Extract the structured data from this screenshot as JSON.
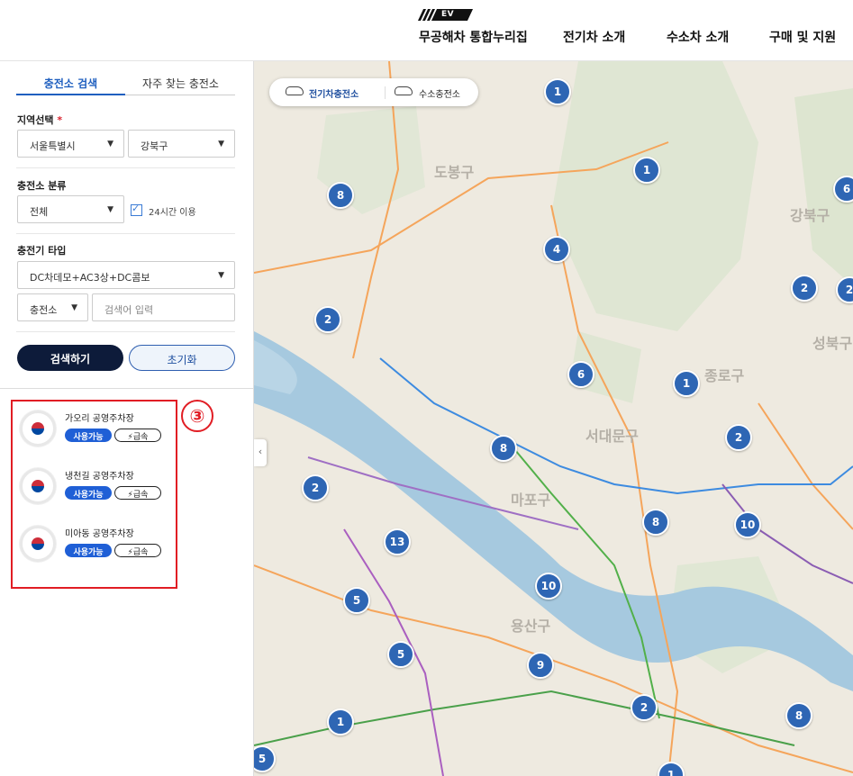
{
  "header": {
    "logo_tag": "EV",
    "nav": [
      "무공해차 통합누리집",
      "전기차 소개",
      "수소차 소개",
      "구매 및 지원"
    ]
  },
  "sidebar": {
    "tabs": [
      "충전소 검색",
      "자주 찾는 충전소"
    ],
    "region": {
      "label": "지역선택",
      "required_mark": "*",
      "city": "서울특별시",
      "district": "강북구"
    },
    "category": {
      "label": "충전소 분류",
      "value": "전체",
      "checkbox_label": "24시간 이용",
      "checked": true
    },
    "charger_type": {
      "label": "충전기 타입",
      "value": "DC차데모+AC3상+DC콤보"
    },
    "search": {
      "field": "충전소",
      "placeholder": "검색어 입력"
    },
    "buttons": {
      "search": "검색하기",
      "reset": "초기화"
    },
    "annotation_number": "③",
    "results": [
      {
        "name": "가오리 공영주차장",
        "status": "사용가능",
        "speed": "급속"
      },
      {
        "name": "냉천길 공영주차장",
        "status": "사용가능",
        "speed": "급속"
      },
      {
        "name": "미아동 공영주차장",
        "status": "사용가능",
        "speed": "급속"
      }
    ]
  },
  "map": {
    "toggle": [
      "전기차충전소",
      "수소충전소"
    ],
    "collapse_glyph": "‹",
    "districts": [
      "도봉구",
      "강북구",
      "성북구",
      "종로구",
      "서대문구",
      "마포구",
      "용산구"
    ],
    "clusters": [
      "1",
      "1",
      "8",
      "4",
      "2",
      "6",
      "1",
      "2",
      "8",
      "2",
      "8",
      "10",
      "13",
      "10",
      "5",
      "5",
      "9",
      "1",
      "2",
      "8",
      "5",
      "2",
      "6",
      "2",
      "1"
    ]
  },
  "colors": {
    "accent": "#1f5fbf",
    "cluster": "#2e66b4",
    "highlight": "#e11d24",
    "river": "#a6c9df"
  }
}
